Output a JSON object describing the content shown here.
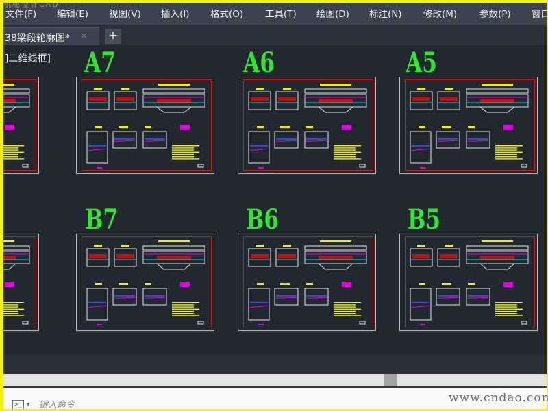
{
  "menu": {
    "ghost_title": "机械设计CAD",
    "items": [
      "文件(F)",
      "编辑(E)",
      "视图(V)",
      "插入(I)",
      "格式(O)",
      "工具(T)",
      "绘图(D)",
      "标注(N)",
      "修改(M)",
      "参数(P)",
      "窗口"
    ]
  },
  "tabs": {
    "active_label": "38梁段轮廓图*",
    "close_glyph": "✕",
    "new_tab_glyph": "+"
  },
  "viewport": {
    "label": "]二维线框]",
    "sheet_labels": [
      "A7",
      "A6",
      "A5",
      "B7",
      "B6",
      "B5"
    ]
  },
  "command": {
    "icon_glyph": ">_",
    "arrow_glyph": "▾",
    "placeholder": "键入命令"
  },
  "watermark": "www.cndao.com",
  "colors": {
    "workspace": "#212830",
    "sheet_frame": "#b8b8b8",
    "sheet_border": "#d01818",
    "label": "#2de82d",
    "yellow": "#f0f000",
    "magenta": "#e000e0",
    "cyan": "#00d8e8",
    "outer_frame": "#f2f20a"
  }
}
